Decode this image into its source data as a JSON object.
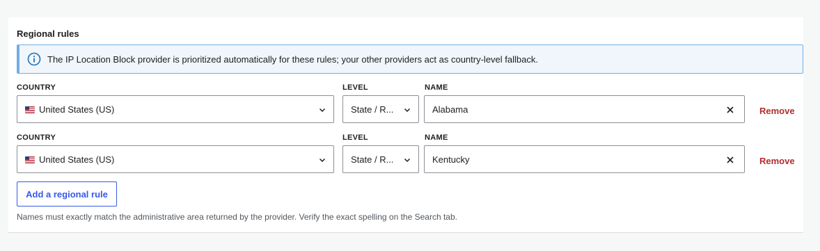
{
  "section": {
    "title": "Regional rules"
  },
  "notice": {
    "icon": "info-icon",
    "text": "The IP Location Block provider is prioritized automatically for these rules; your other providers act as country-level fallback."
  },
  "labels": {
    "country": "COUNTRY",
    "level": "LEVEL",
    "name": "NAME"
  },
  "rules": [
    {
      "country": "United States (US)",
      "level": "State / R...",
      "name": "Alabama",
      "remove_label": "Remove"
    },
    {
      "country": "United States (US)",
      "level": "State / R...",
      "name": "Kentucky",
      "remove_label": "Remove"
    }
  ],
  "add_button": {
    "label": "Add a regional rule"
  },
  "help_text": "Names must exactly match the administrative area returned by the provider. Verify the exact spelling on the Search tab.",
  "colors": {
    "accent": "#3858e9",
    "danger": "#b32d2e",
    "notice_border": "#72aee6",
    "notice_bg": "#f0f6fc",
    "info_icon": "#2271b1"
  }
}
